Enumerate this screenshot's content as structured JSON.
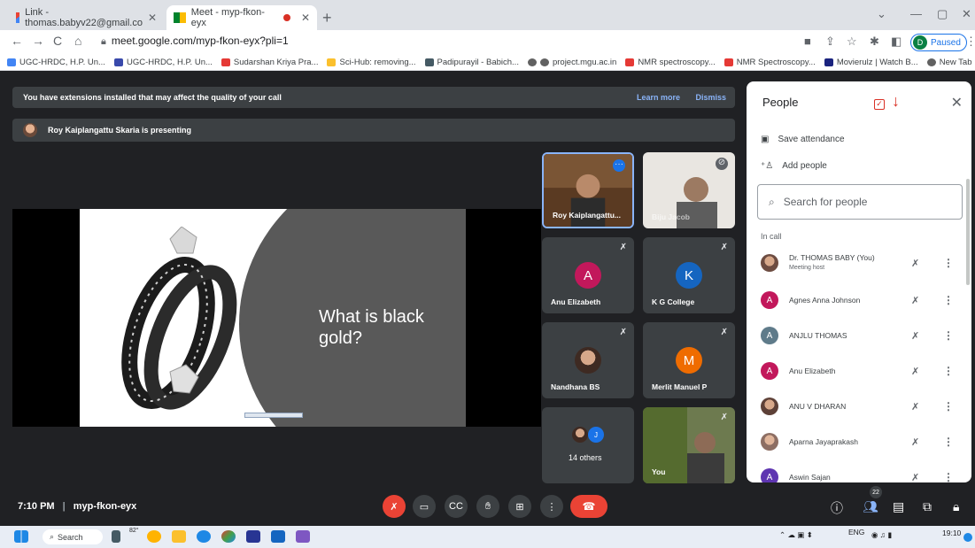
{
  "browser": {
    "tabs": [
      {
        "label": "Link - thomas.babyv22@gmail.co"
      },
      {
        "label": "Meet - myp-fkon-eyx"
      }
    ],
    "url": "meet.google.com/myp-fkon-eyx?pli=1",
    "profile_initial": "D",
    "profile_status": "Paused",
    "bookmarks": [
      "UGC-HRDC, H.P. Un...",
      "UGC-HRDC, H.P. Un...",
      "Sudarshan Kriya Pra...",
      "Sci-Hub: removing...",
      "Padipurayil - Babich...",
      "project.mgu.ac.in",
      "NMR spectroscopy...",
      "NMR Spectroscopy...",
      "Movierulz | Watch B...",
      "New Tab"
    ]
  },
  "meet": {
    "extension_banner": "You have extensions installed that may affect the quality of your call",
    "learn_more": "Learn more",
    "dismiss": "Dismiss",
    "presenting_text": "Roy Kaiplangattu Skaria is presenting",
    "slide_title": "What is black gold?",
    "tiles": [
      {
        "name": "Roy Kaiplangattu..."
      },
      {
        "name": "Biju Jacob"
      },
      {
        "name": "Anu Elizabeth",
        "initial": "A",
        "color": "#c2185b"
      },
      {
        "name": "K G College",
        "initial": "K",
        "color": "#1565c0"
      },
      {
        "name": "Nandhana BS"
      },
      {
        "name": "Merlit Manuel P",
        "initial": "M",
        "color": "#ef6c00"
      },
      {
        "name": "14 others",
        "initial": "J"
      },
      {
        "name": "You"
      }
    ],
    "meeting_time": "7:10 PM",
    "meeting_code": "myp-fkon-eyx",
    "people_count": "22"
  },
  "people_panel": {
    "title": "People",
    "save_attendance": "Save attendance",
    "add_people": "Add people",
    "search_placeholder": "Search for people",
    "section": "In call",
    "participants": [
      {
        "name": "Dr. THOMAS BABY (You)",
        "sub": "Meeting host",
        "initial": "",
        "color": "#8d6e63"
      },
      {
        "name": "Agnes Anna Johnson",
        "initial": "A",
        "color": "#c2185b"
      },
      {
        "name": "ANJLU THOMAS",
        "initial": "A",
        "color": "#5f7b8a"
      },
      {
        "name": "Anu Elizabeth",
        "initial": "A",
        "color": "#c2185b"
      },
      {
        "name": "ANU V DHARAN",
        "initial": "",
        "color": "#6d4c41"
      },
      {
        "name": "Aparna Jayaprakash",
        "initial": "",
        "color": "#a1887f"
      },
      {
        "name": "Aswin Sajan",
        "initial": "A",
        "color": "#5e35b1"
      }
    ]
  },
  "taskbar": {
    "search": "Search",
    "temp": "82°",
    "lang": "ENG",
    "clock": "19:10"
  }
}
